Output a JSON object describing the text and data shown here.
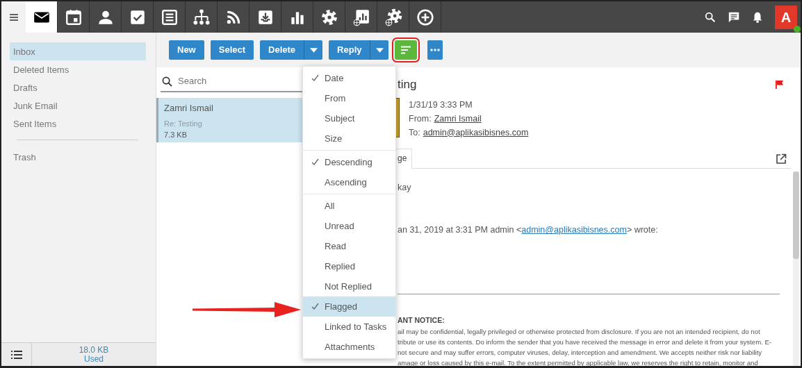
{
  "app_tabs": [
    {
      "kind": "mail",
      "selected": true
    },
    {
      "kind": "calendar",
      "selected": false
    },
    {
      "kind": "contacts",
      "selected": false
    },
    {
      "kind": "tasks",
      "selected": false
    },
    {
      "kind": "notes",
      "selected": false
    },
    {
      "kind": "org",
      "selected": false
    },
    {
      "kind": "rss",
      "selected": false
    },
    {
      "kind": "inbox",
      "selected": false
    },
    {
      "kind": "chart",
      "selected": false
    },
    {
      "kind": "settings",
      "selected": false
    },
    {
      "kind": "report",
      "selected": false
    },
    {
      "kind": "web-settings",
      "selected": false
    },
    {
      "kind": "add",
      "selected": false
    }
  ],
  "user": {
    "initial": "A",
    "online": true
  },
  "folder_groups": [
    [
      {
        "label": "Inbox",
        "selected": true
      },
      {
        "label": "Deleted Items",
        "selected": false
      },
      {
        "label": "Drafts",
        "selected": false
      },
      {
        "label": "Junk Email",
        "selected": false
      },
      {
        "label": "Sent Items",
        "selected": false
      }
    ],
    [
      {
        "label": "Trash",
        "selected": false
      }
    ]
  ],
  "storage": {
    "amount": "18.0 KB",
    "label": "Used"
  },
  "toolbar": [
    {
      "kind": "button",
      "label": "New"
    },
    {
      "kind": "button",
      "label": "Select"
    },
    {
      "kind": "split",
      "label": "Delete"
    },
    {
      "kind": "split",
      "label": "Reply"
    },
    {
      "kind": "sort",
      "open": true,
      "highlighted": true
    },
    {
      "kind": "more"
    }
  ],
  "search": {
    "placeholder": "Search"
  },
  "messages": [
    {
      "sender": "Zamri Ismail",
      "subject": "Re: Testing",
      "size": "7.3 KB",
      "selected": true
    }
  ],
  "sort_menu": [
    [
      {
        "label": "Date",
        "checked": true,
        "selected": false
      },
      {
        "label": "From",
        "checked": false,
        "selected": false
      },
      {
        "label": "Subject",
        "checked": false,
        "selected": false
      },
      {
        "label": "Size",
        "checked": false,
        "selected": false
      }
    ],
    [
      {
        "label": "Descending",
        "checked": true,
        "selected": false
      },
      {
        "label": "Ascending",
        "checked": false,
        "selected": false
      }
    ],
    [
      {
        "label": "All",
        "checked": false,
        "selected": false
      },
      {
        "label": "Unread",
        "checked": false,
        "selected": false
      },
      {
        "label": "Read",
        "checked": false,
        "selected": false
      },
      {
        "label": "Replied",
        "checked": false,
        "selected": false
      },
      {
        "label": "Not Replied",
        "checked": false,
        "selected": false
      },
      {
        "label": "Flagged",
        "checked": true,
        "selected": true
      },
      {
        "label": "Linked to Tasks",
        "checked": false,
        "selected": false
      },
      {
        "label": "Attachments",
        "checked": false,
        "selected": false
      }
    ]
  ],
  "reading": {
    "subject": "ting",
    "flagged": true,
    "date": "1/31/19 3:33 PM",
    "from_label": "From:",
    "from": "Zamri Ismail",
    "to_label": "To:",
    "to": "admin@aplikasibisnes.com",
    "tab": "ge",
    "body": "kay",
    "quote": {
      "prefix": "an 31, 2019 at 3:31 PM admin <",
      "link": "admin@aplikasibisnes.com",
      "suffix": "> wrote:"
    },
    "notice_title": "ANT NOTICE:",
    "notice_lines": [
      "ail may be confidential, legally privileged or otherwise protected from disclosure. If you are not an intended recipient, do not",
      "tribute or use its contents. Do inform the sender that you have received the message in error and delete it from your system. E-",
      "not secure and may suffer errors, computer viruses, delay, interception and amendment. We accepts neither risk nor liability",
      "amage or loss caused by this e-mail. To the extent permitted by applicable law, we reserves the right to retain, monitor and"
    ]
  }
}
